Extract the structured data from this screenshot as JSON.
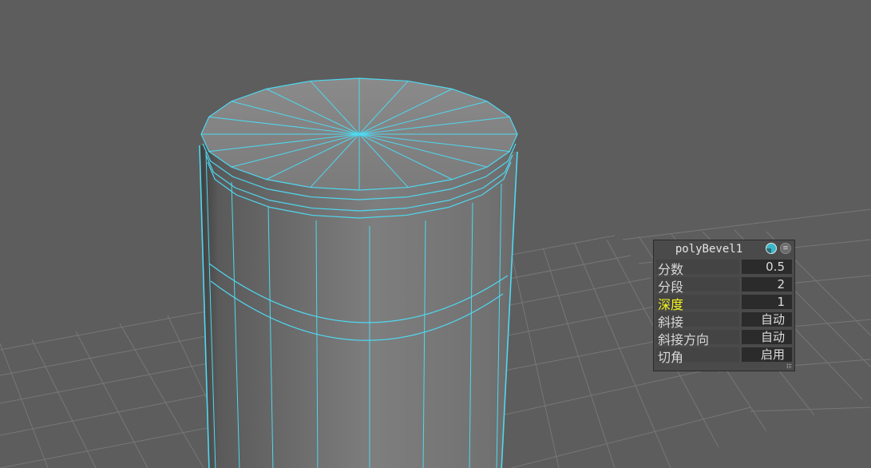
{
  "viewport": {
    "background_color": "#5d5d5d",
    "wire_color": "#4fd8f0",
    "grid_color": "#777777"
  },
  "hud": {
    "title": "polyBevel1",
    "icons": [
      "node-shading-icon",
      "menu-icon"
    ],
    "rows": [
      {
        "label": "分数",
        "value": "0.5"
      },
      {
        "label": "分段",
        "value": "2"
      },
      {
        "label": "深度",
        "value": "1",
        "highlighted": true
      },
      {
        "label": "斜接",
        "value": "自动"
      },
      {
        "label": "斜接方向",
        "value": "自动"
      },
      {
        "label": "切角",
        "value": "启用"
      }
    ],
    "highlight_color": "#f4f41e"
  }
}
